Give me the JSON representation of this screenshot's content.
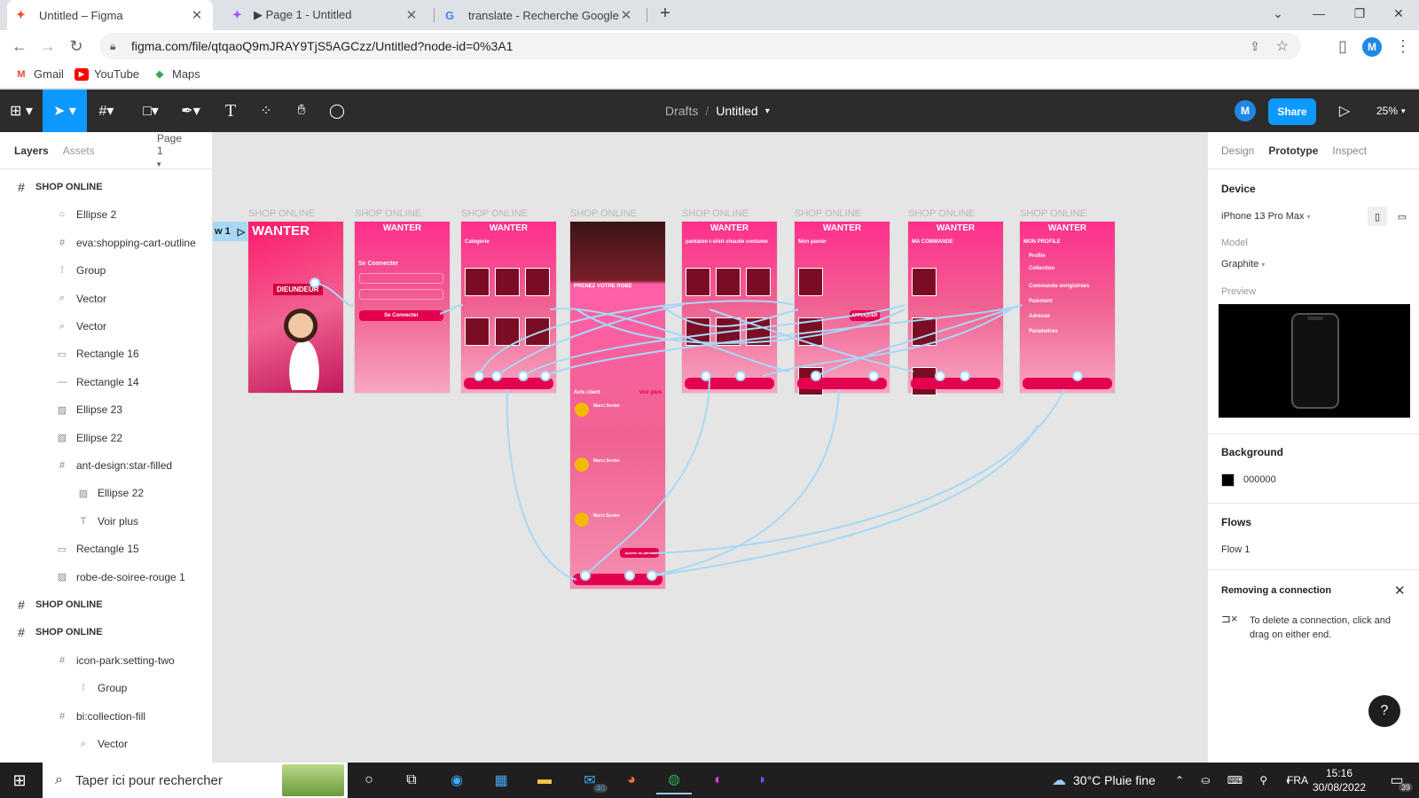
{
  "browser": {
    "tabs": [
      {
        "label": "Untitled – Figma",
        "icon": "figma-icon",
        "active": true
      },
      {
        "label": "▶ Page 1 - Untitled",
        "icon": "figma-icon",
        "active": false
      },
      {
        "label": "translate - Recherche Google",
        "icon": "google-icon",
        "active": false
      }
    ],
    "url": "figma.com/file/qtqaoQ9mJRAY9TjS5AGCzz/Untitled?node-id=0%3A1",
    "bookmarks": [
      {
        "label": "Gmail",
        "icon": "gmail-icon"
      },
      {
        "label": "YouTube",
        "icon": "youtube-icon"
      },
      {
        "label": "Maps",
        "icon": "maps-icon"
      }
    ],
    "profile_initial": "M"
  },
  "figma": {
    "breadcrumb": {
      "parent": "Drafts",
      "separator": "/",
      "file": "Untitled"
    },
    "avatar": "M",
    "share_label": "Share",
    "zoom": "25%"
  },
  "layers_panel": {
    "tabs": [
      "Layers",
      "Assets"
    ],
    "page": "Page 1",
    "items": [
      {
        "label": "SHOP ONLINE",
        "icon": "frame-icon",
        "indent": 0
      },
      {
        "label": "Ellipse 2",
        "icon": "ellipse-icon",
        "indent": 1
      },
      {
        "label": "eva:shopping-cart-outline",
        "icon": "frame-icon",
        "indent": 1
      },
      {
        "label": "Group",
        "icon": "group-icon",
        "indent": 1
      },
      {
        "label": "Vector",
        "icon": "vector-icon",
        "indent": 1
      },
      {
        "label": "Vector",
        "icon": "vector-icon",
        "indent": 1
      },
      {
        "label": "Rectangle 16",
        "icon": "rectangle-icon",
        "indent": 1
      },
      {
        "label": "Rectangle 14",
        "icon": "line-icon",
        "indent": 1
      },
      {
        "label": "Ellipse 23",
        "icon": "image-icon",
        "indent": 1
      },
      {
        "label": "Ellipse 22",
        "icon": "image-icon",
        "indent": 1
      },
      {
        "label": "ant-design:star-filled",
        "icon": "frame-icon",
        "indent": 1
      },
      {
        "label": "Ellipse 22",
        "icon": "image-icon",
        "indent": 2
      },
      {
        "label": "Voir plus",
        "icon": "text-icon",
        "indent": 2
      },
      {
        "label": "Rectangle 15",
        "icon": "rectangle-icon",
        "indent": 1
      },
      {
        "label": "robe-de-soiree-rouge 1",
        "icon": "image-icon",
        "indent": 1
      },
      {
        "label": "SHOP ONLINE",
        "icon": "frame-icon",
        "indent": 0
      },
      {
        "label": "SHOP ONLINE",
        "icon": "frame-icon",
        "indent": 0
      },
      {
        "label": "icon-park:setting-two",
        "icon": "frame-icon",
        "indent": 1
      },
      {
        "label": "Group",
        "icon": "group-icon",
        "indent": 2
      },
      {
        "label": "bi:collection-fill",
        "icon": "frame-icon",
        "indent": 1
      },
      {
        "label": "Vector",
        "icon": "vector-icon",
        "indent": 2
      }
    ]
  },
  "canvas": {
    "flow_label": "w 1",
    "frame_title": "SHOP ONLINE",
    "frames": [
      {
        "title": "SHOP ONLINE",
        "heading": "WANTER",
        "sub": "DIEUNDEUR"
      },
      {
        "title": "SHOP ONLINE",
        "heading": "WANTER",
        "sub": "Se Connecter",
        "button": "Se Connecter"
      },
      {
        "title": "SHOP ONLINE",
        "heading": "WANTER",
        "sub": "Categorie"
      },
      {
        "title": "SHOP ONLINE",
        "heading": "",
        "sub": "PRENEZ VOTRE ROBE",
        "extra": "Avis client",
        "extra2": "Voir plus",
        "reviewer": "Marci Senter",
        "button": "Ajouter au panier"
      },
      {
        "title": "SHOP ONLINE",
        "heading": "WANTER",
        "sub": "pantalon  t-shirt  chaude  costume"
      },
      {
        "title": "SHOP ONLINE",
        "heading": "WANTER",
        "sub": "Mon panier",
        "button": "APPLIQUER"
      },
      {
        "title": "SHOP ONLINE",
        "heading": "WANTER",
        "sub": "MA COMMANDE"
      },
      {
        "title": "SHOP ONLINE",
        "heading": "WANTER",
        "sub": "MON PROFILE",
        "menu": [
          "Profile",
          "Collection",
          "Commande enrigistrées",
          "Paiement",
          "Adresse",
          "Parametres"
        ]
      }
    ]
  },
  "right_panel": {
    "tabs": [
      "Design",
      "Prototype",
      "Inspect"
    ],
    "active_tab": "Prototype",
    "device_label": "Device",
    "device": "iPhone 13 Pro Max",
    "model_label": "Model",
    "model": "Graphite",
    "preview_label": "Preview",
    "background_label": "Background",
    "background_value": "000000",
    "flows_label": "Flows",
    "flow": "Flow 1",
    "removing_title": "Removing a connection",
    "removing_text": "To delete a connection, click and drag on either end."
  },
  "taskbar": {
    "search_placeholder": "Taper ici pour rechercher",
    "weather": "30°C  Pluie fine",
    "lang": "FRA",
    "time": "15:16",
    "date": "30/08/2022",
    "mail_badge": "40",
    "notif_badge": "39"
  },
  "colors": {
    "figma_blue": "#0d99ff",
    "frame_pink": "#ff2f8d",
    "connector": "#a8d8f5"
  }
}
